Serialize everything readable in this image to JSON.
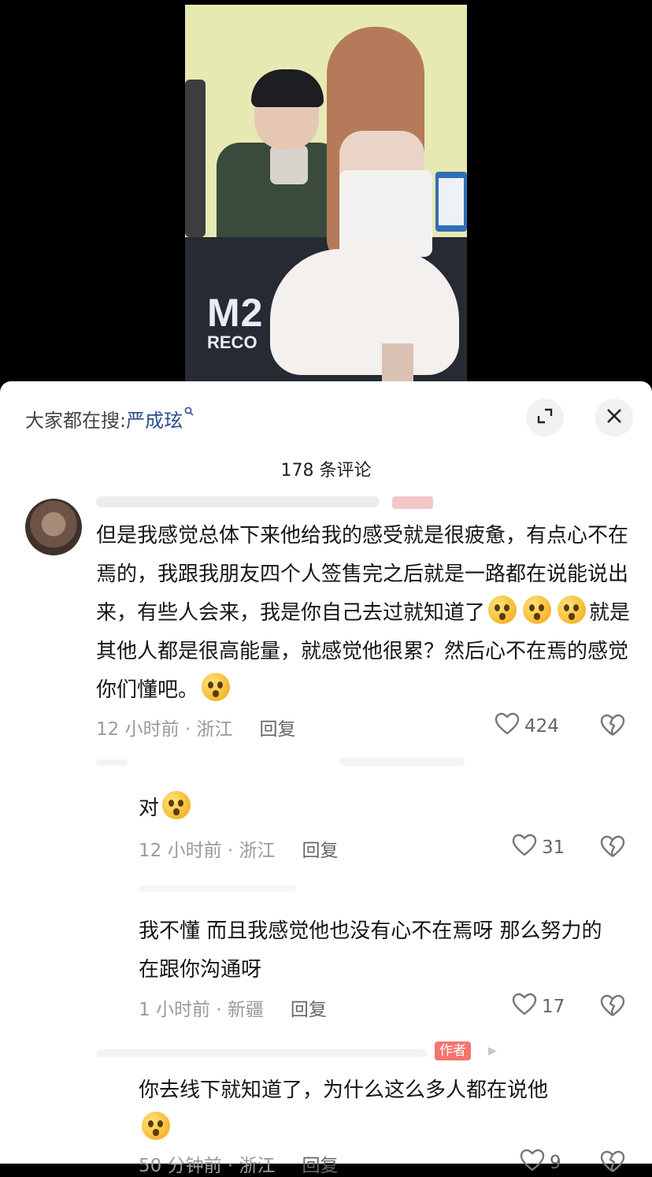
{
  "search": {
    "prefix": "大家都在搜:",
    "keyword": "严成玹"
  },
  "video": {
    "logo_line1": "M2",
    "logo_line2": "RECO"
  },
  "comment_count": "178 条评论",
  "comments": [
    {
      "text_a": "但是我感觉总体下来他给我的感受就是很疲惫，有点心不在焉的，我跟我朋友四个人签售完之后就是一路都在说能说出来，有些人会来，我是你自己去过就知道了",
      "text_b": "就是其他人都是很高能量，就感觉他很累？然后心不在焉的感觉你们懂吧。",
      "time": "12 小时前 · 浙江",
      "reply": "回复",
      "likes": "424"
    },
    {
      "text": "对",
      "time": "12 小时前 · 浙江",
      "reply": "回复",
      "likes": "31"
    },
    {
      "text": "我不懂 而且我感觉他也没有心不在焉呀 那么努力的在跟你沟通呀",
      "time": "1 小时前 · 新疆",
      "reply": "回复",
      "likes": "17"
    },
    {
      "author_tag": "作者",
      "text": "你去线下就知道了，为什么这么多人都在说他",
      "time": "50 分钟前 · 浙江",
      "reply": "回复",
      "likes": "9"
    }
  ]
}
